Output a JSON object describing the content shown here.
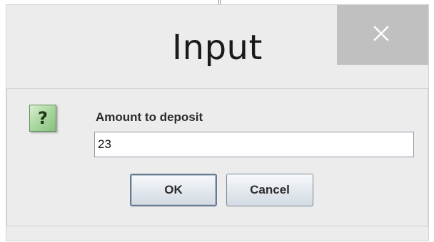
{
  "dialog": {
    "title": "Input",
    "close_icon": "close-icon",
    "message_icon": "question-icon",
    "message_icon_glyph": "?",
    "prompt": "Amount to deposit",
    "input_value": "23",
    "ok_label": "OK",
    "cancel_label": "Cancel"
  },
  "colors": {
    "dialog_background": "#ececec",
    "close_button_background": "#c0c0c0",
    "icon_green": "#a7d49c"
  }
}
